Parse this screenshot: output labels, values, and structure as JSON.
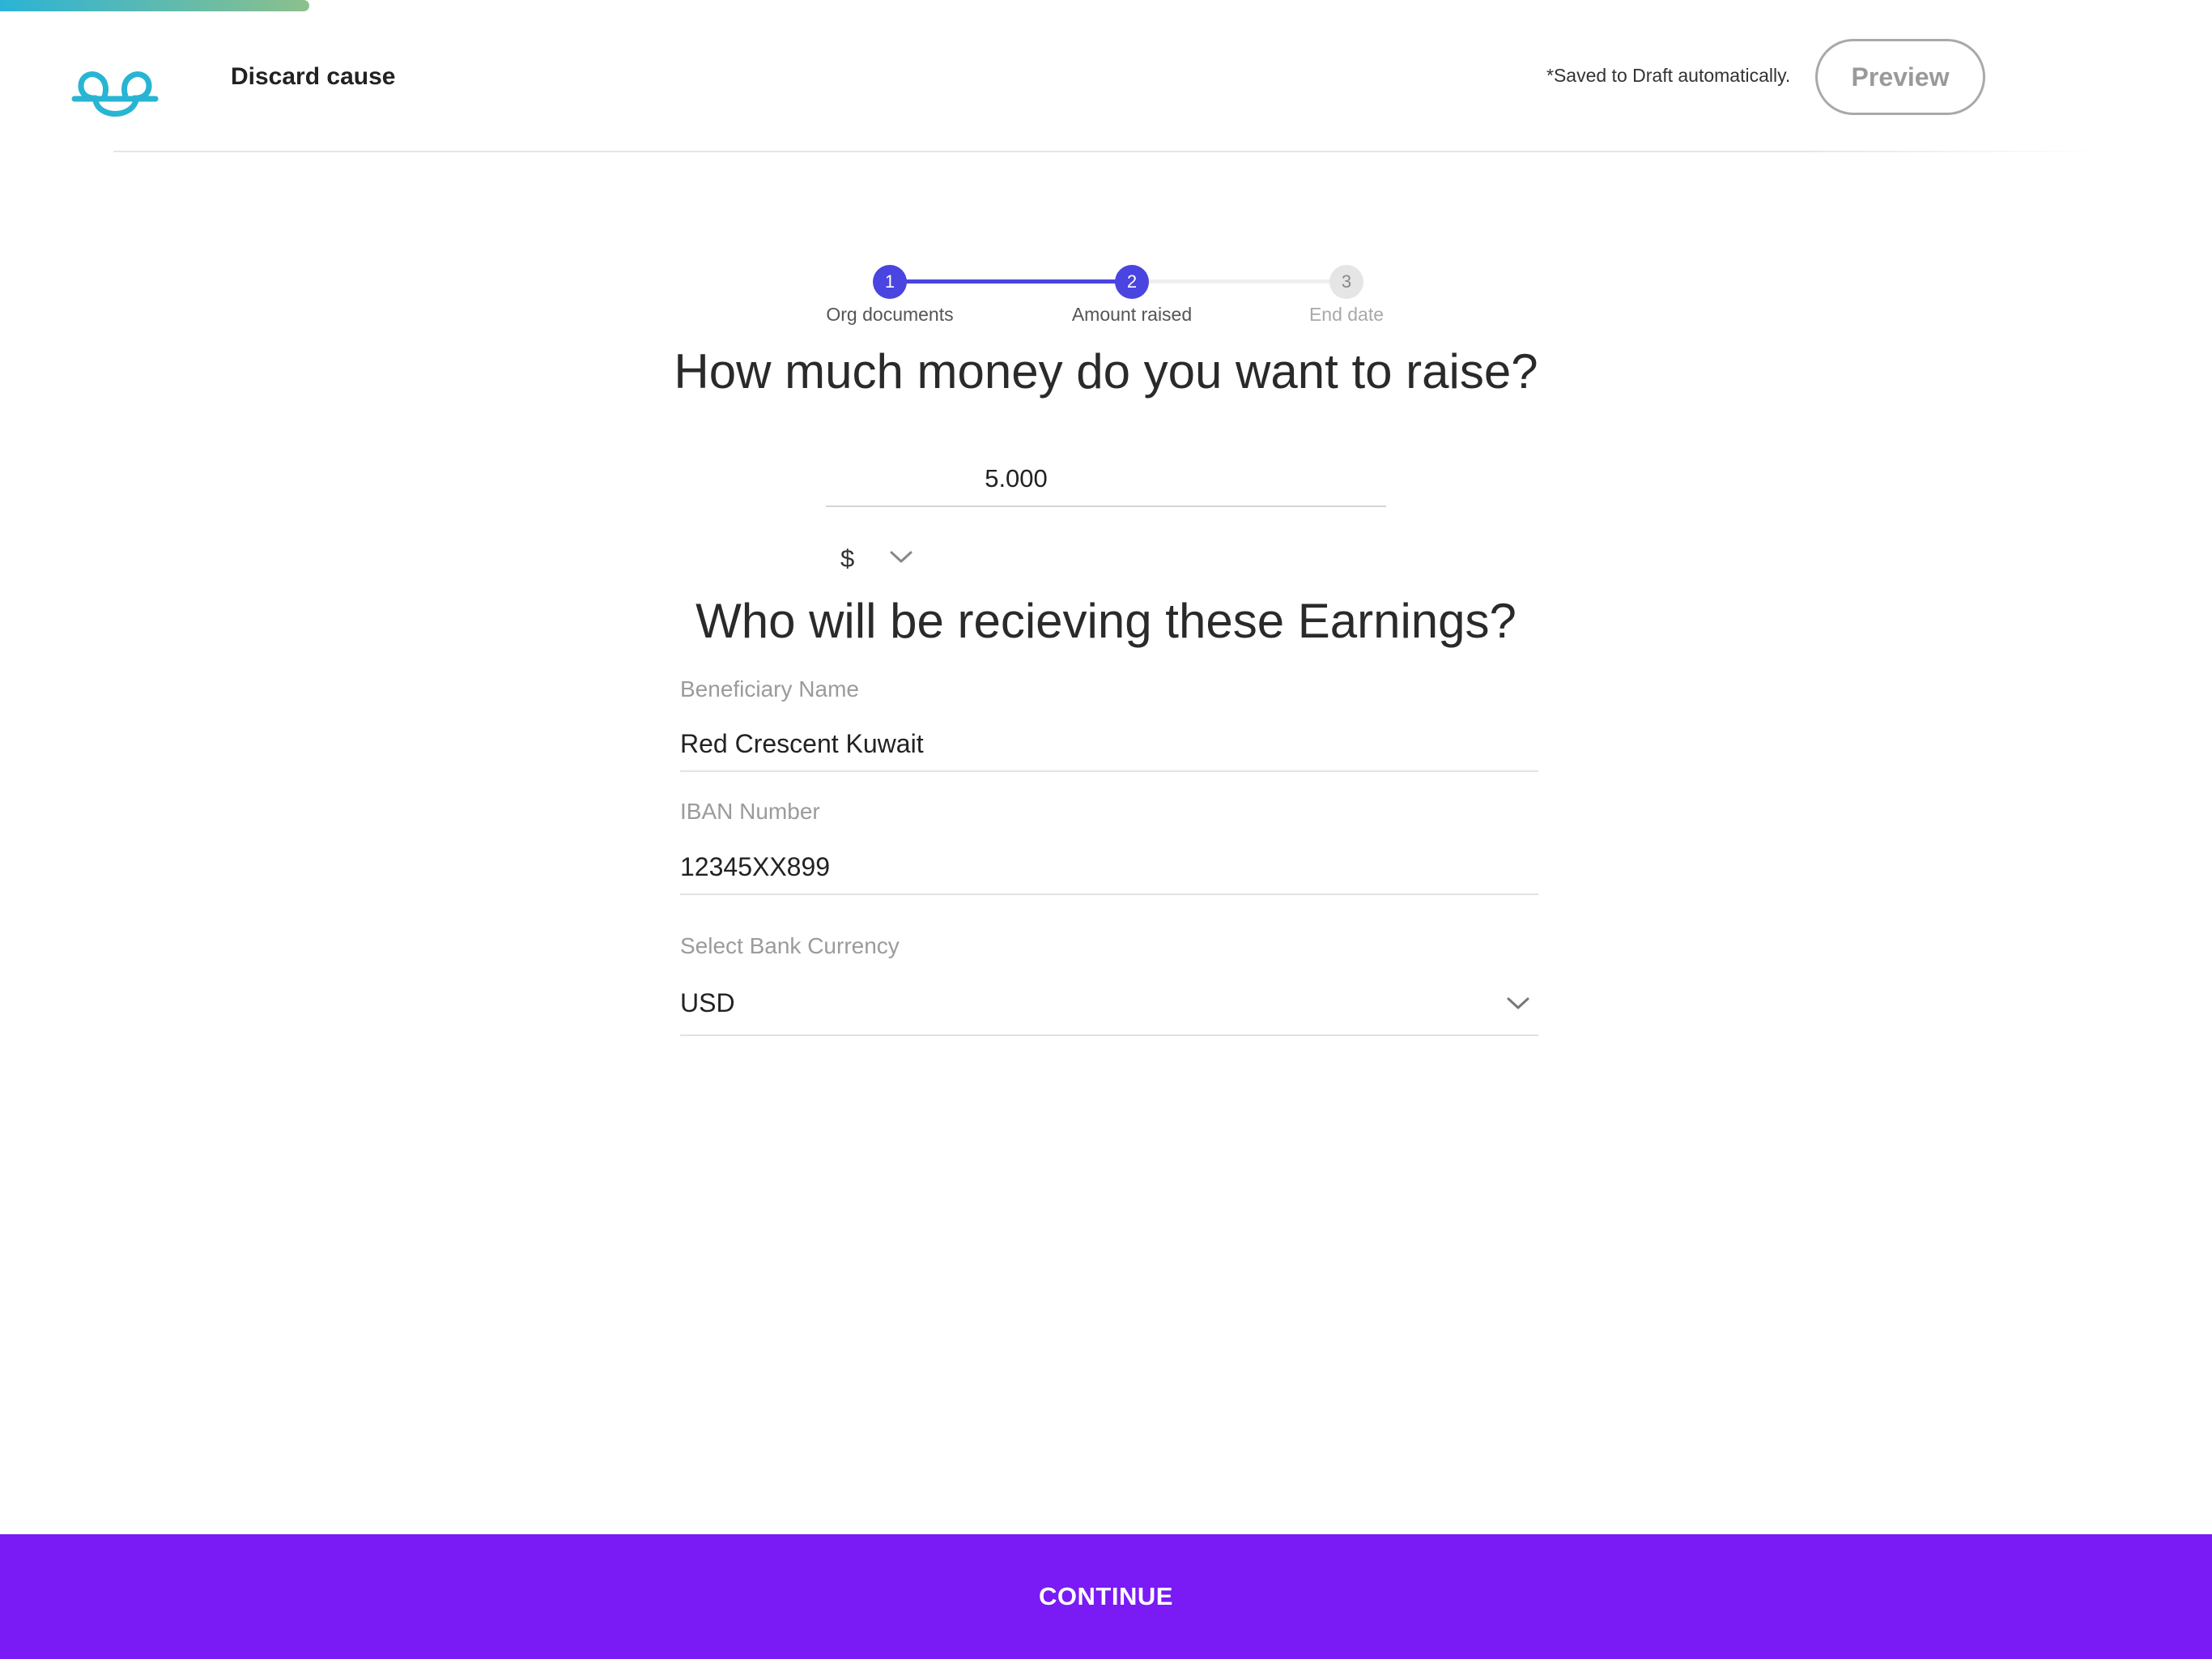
{
  "header": {
    "discard_label": "Discard cause",
    "saved_note": "*Saved to Draft automatically.",
    "preview_label": "Preview"
  },
  "stepper": {
    "steps": [
      {
        "number": "1",
        "label": "Org documents",
        "state": "complete"
      },
      {
        "number": "2",
        "label": "Amount raised",
        "state": "active"
      },
      {
        "number": "3",
        "label": "End date",
        "state": "upcoming"
      }
    ],
    "active_color": "#4a44e0",
    "inactive_color": "#e5e5e5"
  },
  "amount_section": {
    "question": "How much money do you want to raise?",
    "amount_value": "5.000",
    "currency_symbol": "$"
  },
  "beneficiary_section": {
    "question": "Who will be recieving these Earnings?",
    "beneficiary_name_label": "Beneficiary Name",
    "beneficiary_name_value": "Red Crescent Kuwait",
    "iban_label": "IBAN Number",
    "iban_value": "12345XX899",
    "bank_currency_label": "Select Bank Currency",
    "bank_currency_value": "USD"
  },
  "footer": {
    "continue_label": "CONTINUE",
    "accent_color": "#7a1af5"
  },
  "icons": [
    "app-logo-icon",
    "chevron-down-icon"
  ]
}
